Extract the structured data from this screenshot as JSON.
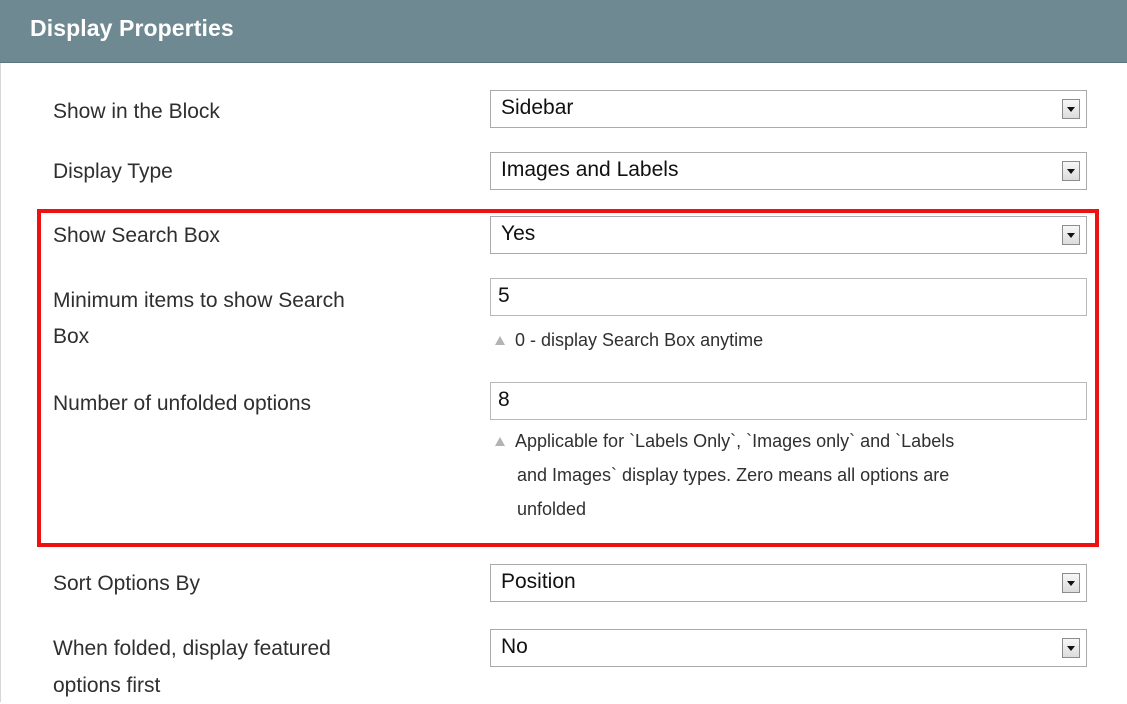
{
  "header": {
    "title": "Display Properties"
  },
  "fields": {
    "show_in_block": {
      "label": "Show in the Block",
      "value": "Sidebar"
    },
    "display_type": {
      "label": "Display Type",
      "value": "Images and Labels"
    },
    "show_search_box": {
      "label": "Show Search Box",
      "value": "Yes"
    },
    "min_items": {
      "label_line1": "Minimum items to show Search",
      "label_line2": "Box",
      "value": "5",
      "note": "0 - display Search Box anytime"
    },
    "unfolded_options": {
      "label": "Number of unfolded options",
      "value": "8",
      "note_line1": "Applicable for `Labels Only`, `Images only` and `Labels",
      "note_line2": "and Images` display types. Zero means all options are",
      "note_line3": "unfolded"
    },
    "sort_options": {
      "label": "Sort Options By",
      "value": "Position"
    },
    "featured_first": {
      "label_line1": "When folded, display featured",
      "label_line2": "options first",
      "value": "No"
    }
  },
  "colors": {
    "header_bg": "#6f8992",
    "highlight_border": "#ee1111"
  }
}
